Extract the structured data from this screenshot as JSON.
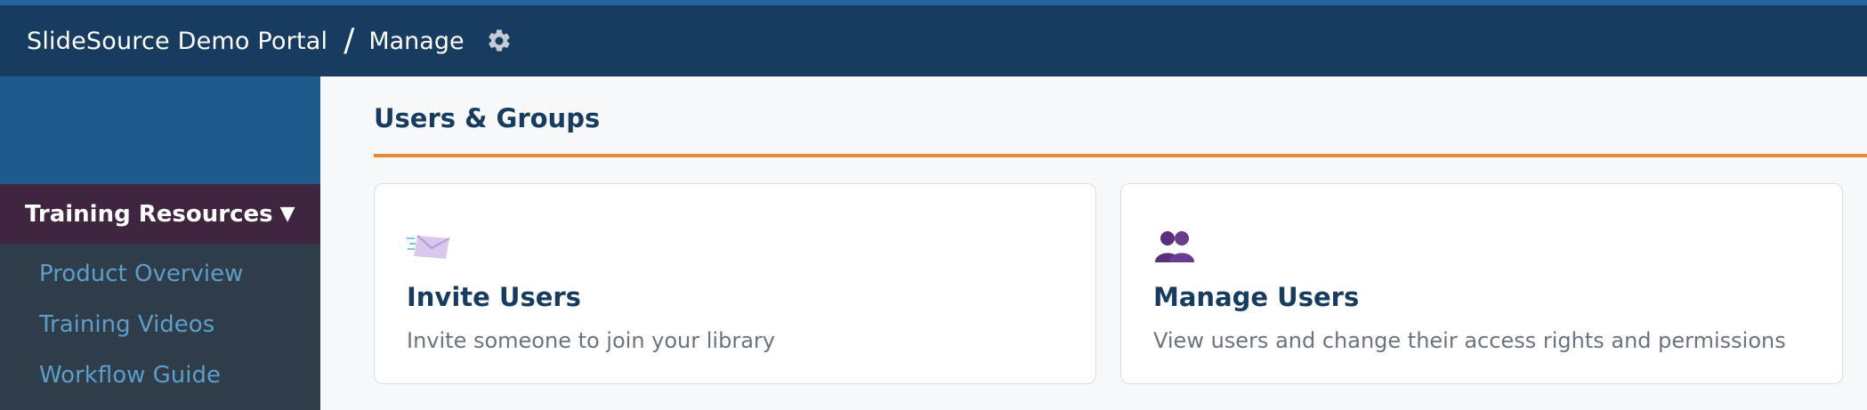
{
  "header": {
    "portal_name": "SlideSource Demo Portal",
    "separator": "/",
    "page": "Manage",
    "settings_icon": "gear-icon"
  },
  "sidebar": {
    "section_label": "Training Resources",
    "section_caret": "▼",
    "items": [
      {
        "label": "Product Overview"
      },
      {
        "label": "Training Videos"
      },
      {
        "label": "Workflow Guide"
      }
    ]
  },
  "main": {
    "section_title": "Users & Groups",
    "cards": [
      {
        "title": "Invite Users",
        "description": "Invite someone to join your library",
        "icon": "envelope-icon"
      },
      {
        "title": "Manage Users",
        "description": "View users and change their access rights and permissions",
        "icon": "users-icon"
      }
    ]
  },
  "colors": {
    "header_bg": "#173c5f",
    "sidebar_accent": "#3f2540",
    "link": "#5d9ec9",
    "rule_accent": "#e8892f"
  }
}
